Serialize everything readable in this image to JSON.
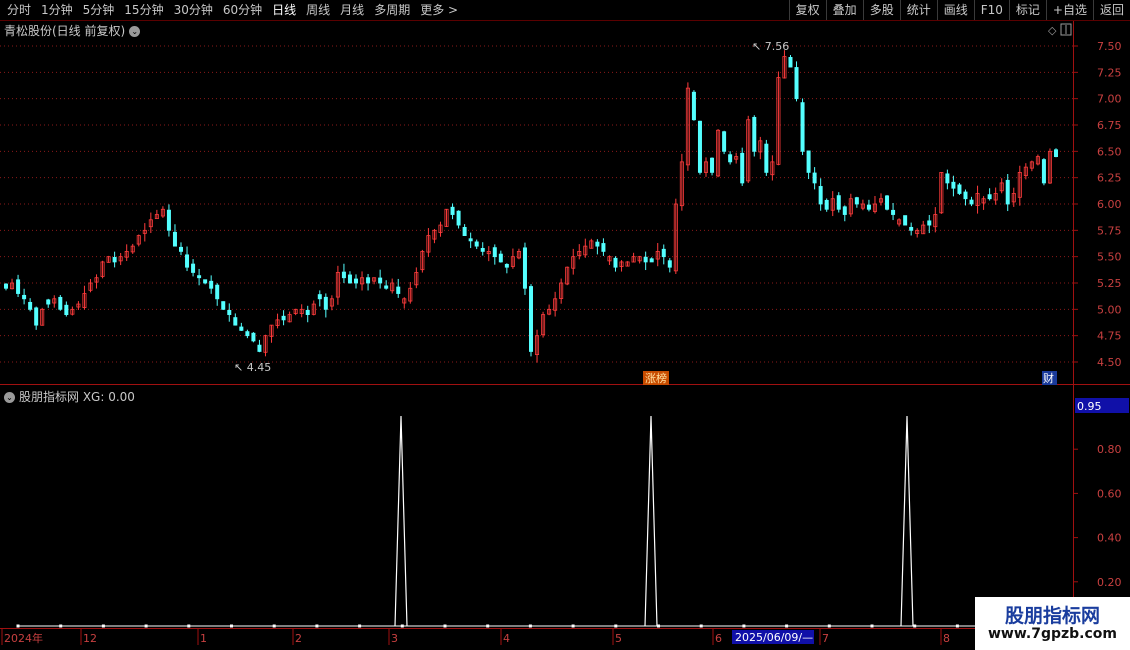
{
  "toolbar": {
    "periods": [
      "分时",
      "1分钟",
      "5分钟",
      "15分钟",
      "30分钟",
      "60分钟",
      "日线",
      "周线",
      "月线",
      "多周期",
      "更多 >"
    ],
    "active_period": "日线",
    "right_buttons": [
      "复权",
      "叠加",
      "多股",
      "统计",
      "画线",
      "F10",
      "标记",
      "+自选",
      "返回"
    ]
  },
  "main_panel": {
    "title": "青松股份(日线 前复权)",
    "max_label": "7.56",
    "min_label": "4.45",
    "tag_zhangbang": "涨榜",
    "tag_cai": "财",
    "y_ticks": [
      "7.50",
      "7.25",
      "7.00",
      "6.75",
      "6.50",
      "6.25",
      "6.00",
      "5.75",
      "5.50",
      "5.25",
      "5.00",
      "4.75",
      "4.50"
    ]
  },
  "sub_panel": {
    "title": "股朋指标网 XG: 0.00",
    "current_value": "0.95",
    "y_ticks": [
      "0.80",
      "0.60",
      "0.40",
      "0.20"
    ]
  },
  "x_axis": {
    "labels": [
      "2024年",
      "12",
      "1",
      "2",
      "3",
      "4",
      "5",
      "6",
      "7",
      "8"
    ],
    "highlight_date": "2025/06/09/—"
  },
  "watermark": {
    "line1": "股朋指标网",
    "line2": "www.7gpzb.com"
  },
  "colors": {
    "up": "#ff3c3c",
    "down": "#54ffff",
    "grid": "#8a1a1a",
    "xg_line": "#ffffff"
  },
  "chart_data": {
    "type": "candlestick",
    "y_range": [
      4.4,
      7.6
    ],
    "y_ticks": [
      4.5,
      4.75,
      5.0,
      5.25,
      5.5,
      5.75,
      6.0,
      6.25,
      6.5,
      6.75,
      7.0,
      7.25,
      7.5
    ],
    "max_marker": 7.56,
    "min_marker": 4.45,
    "closes": [
      5.2,
      5.25,
      5.15,
      5.1,
      5.0,
      4.85,
      5.0,
      5.05,
      5.1,
      5.0,
      4.95,
      5.0,
      5.05,
      5.15,
      5.25,
      5.3,
      5.45,
      5.5,
      5.45,
      5.5,
      5.55,
      5.6,
      5.7,
      5.75,
      5.85,
      5.9,
      5.95,
      5.75,
      5.6,
      5.55,
      5.4,
      5.35,
      5.3,
      5.25,
      5.2,
      5.1,
      5.0,
      4.95,
      4.85,
      4.8,
      4.75,
      4.7,
      4.6,
      4.75,
      4.85,
      4.9,
      4.9,
      4.95,
      5.0,
      5.0,
      4.95,
      5.05,
      5.1,
      5.0,
      5.1,
      5.35,
      5.3,
      5.25,
      5.25,
      5.3,
      5.25,
      5.3,
      5.25,
      5.2,
      5.25,
      5.15,
      5.1,
      5.2,
      5.35,
      5.55,
      5.7,
      5.75,
      5.8,
      5.95,
      5.9,
      5.8,
      5.7,
      5.65,
      5.6,
      5.55,
      5.55,
      5.5,
      5.45,
      5.4,
      5.5,
      5.55,
      5.2,
      4.6,
      4.75,
      4.95,
      5.0,
      5.1,
      5.25,
      5.4,
      5.5,
      5.55,
      5.6,
      5.65,
      5.6,
      5.55,
      5.5,
      5.4,
      5.45,
      5.45,
      5.5,
      5.5,
      5.45,
      5.45,
      5.55,
      5.5,
      5.4,
      6.0,
      6.4,
      7.1,
      6.8,
      6.3,
      6.4,
      6.3,
      6.7,
      6.5,
      6.4,
      6.45,
      6.2,
      6.8,
      6.5,
      6.6,
      6.3,
      6.4,
      7.2,
      7.4,
      7.3,
      7.0,
      6.5,
      6.3,
      6.2,
      6.0,
      5.95,
      6.05,
      5.95,
      5.9,
      6.05,
      6.0,
      6.0,
      5.95,
      6.0,
      6.05,
      5.95,
      5.9,
      5.85,
      5.8,
      5.75,
      5.75,
      5.8,
      5.8,
      5.9,
      6.3,
      6.2,
      6.15,
      6.1,
      6.05,
      6.0,
      6.1,
      6.05,
      6.05,
      6.1,
      6.2,
      6.0,
      6.1,
      6.3,
      6.35,
      6.4,
      6.45,
      6.2,
      6.5,
      6.45
    ],
    "xg_signals": [
      {
        "index": 88,
        "value": 0.95
      },
      {
        "index": 150,
        "value": 0.95
      },
      {
        "index": 213,
        "value": 0.95
      }
    ],
    "xg_range": [
      0,
      1.0
    ],
    "x_labels": [
      "2024年",
      "12",
      "1",
      "2",
      "3",
      "4",
      "5",
      "6",
      "7",
      "8"
    ]
  }
}
